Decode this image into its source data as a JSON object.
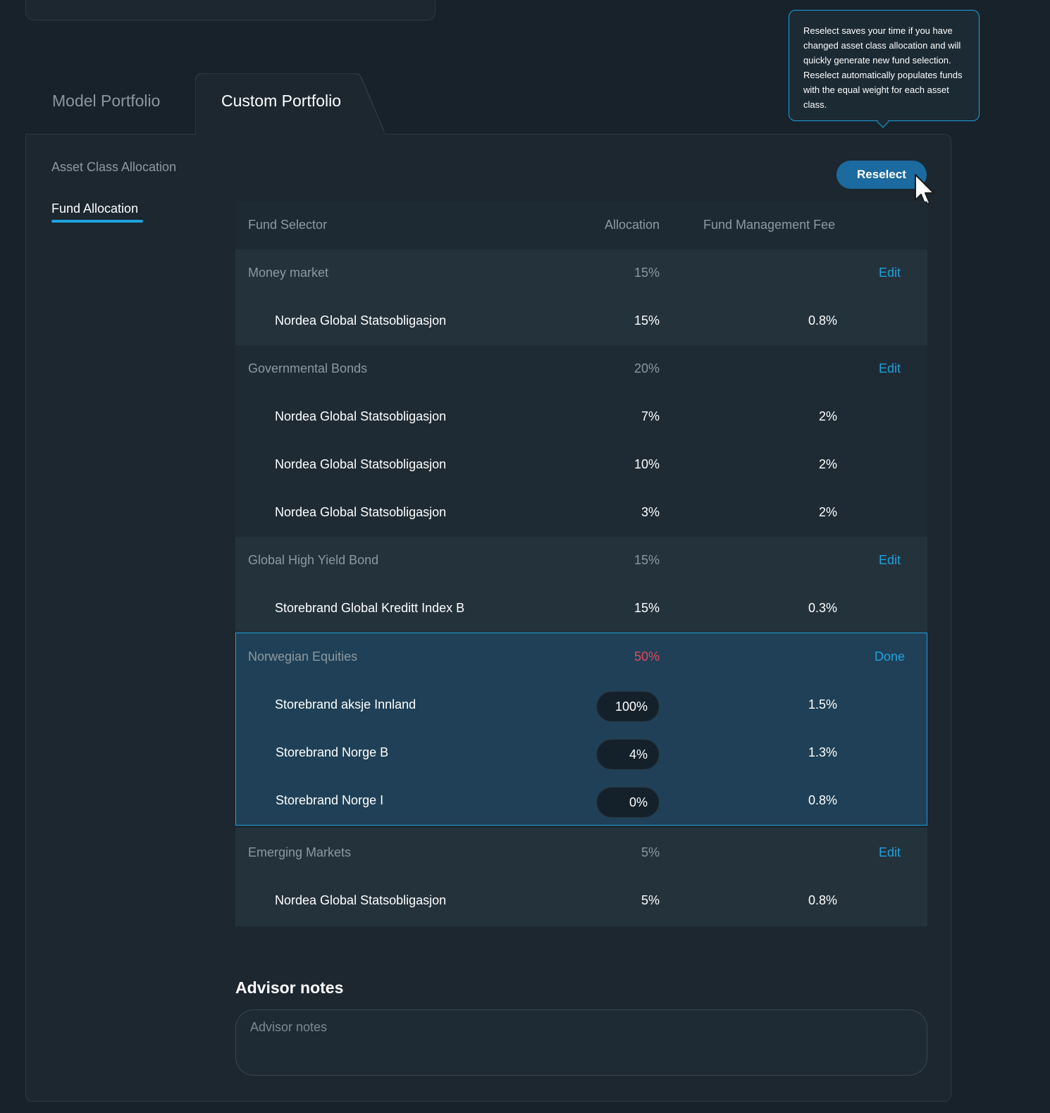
{
  "tabs": {
    "model": "Model Portfolio",
    "custom": "Custom Portfolio"
  },
  "side_nav": {
    "asset_class": "Asset Class Allocation",
    "fund_allocation": "Fund Allocation"
  },
  "toolbar": {
    "reselect_label": "Reselect"
  },
  "tooltip": {
    "text": "Reselect saves your time if you have changed asset class allocation and will quickly generate new fund selection. Reselect automatically populates funds with the equal weight for each asset class."
  },
  "table": {
    "headers": {
      "fund_selector": "Fund Selector",
      "allocation": "Allocation",
      "fee": "Fund Management Fee"
    },
    "groups": [
      {
        "name": "Money market",
        "allocation": "15%",
        "action": "Edit",
        "funds": [
          {
            "name": "Nordea Global Statsobligasjon",
            "allocation": "15%",
            "fee": "0.8%"
          }
        ]
      },
      {
        "name": "Governmental Bonds",
        "allocation": "20%",
        "action": "Edit",
        "funds": [
          {
            "name": "Nordea Global Statsobligasjon",
            "allocation": "7%",
            "fee": "2%"
          },
          {
            "name": "Nordea Global Statsobligasjon",
            "allocation": "10%",
            "fee": "2%"
          },
          {
            "name": "Nordea Global Statsobligasjon",
            "allocation": "3%",
            "fee": "2%"
          }
        ]
      },
      {
        "name": "Global High Yield Bond",
        "allocation": "15%",
        "action": "Edit",
        "funds": [
          {
            "name": "Storebrand Global Kreditt Index B",
            "allocation": "15%",
            "fee": "0.3%"
          }
        ]
      },
      {
        "name": "Norwegian Equities",
        "allocation": "50%",
        "action": "Done",
        "funds": [
          {
            "name": "Storebrand aksje Innland",
            "allocation": "100%",
            "fee": "1.5%"
          },
          {
            "name": "Storebrand Norge B",
            "allocation": "4%",
            "fee": "1.3%"
          },
          {
            "name": "Storebrand Norge I",
            "allocation": "0%",
            "fee": "0.8%"
          }
        ]
      },
      {
        "name": "Emerging Markets",
        "allocation": "5%",
        "action": "Edit",
        "funds": [
          {
            "name": "Nordea Global Statsobligasjon",
            "allocation": "5%",
            "fee": "0.8%"
          }
        ]
      }
    ]
  },
  "advisor_notes": {
    "title": "Advisor notes",
    "placeholder": "Advisor notes"
  },
  "colors": {
    "background": "#18222b",
    "accent": "#1ea2dc",
    "button": "#1b6aa0",
    "warning": "#e2495b"
  }
}
